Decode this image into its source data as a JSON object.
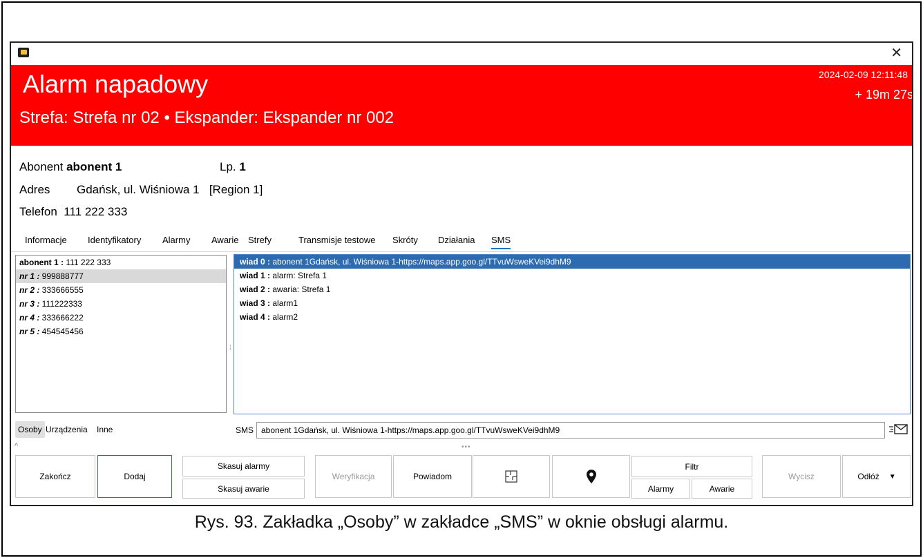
{
  "alarm": {
    "title": "Alarm napadowy",
    "subtitle": "Strefa: Strefa nr 02 • Ekspander: Ekspander nr 002",
    "date": "2024-02-09 12:11:48",
    "elapsed": "+ 19m 27s",
    "color": "#ff0000"
  },
  "info": {
    "abonent_label": "Abonent",
    "abonent_value": "abonent 1",
    "lp_label": "Lp.",
    "lp_value": "1",
    "adres_label": "Adres",
    "adres_value": "Gdańsk, ul. Wiśniowa 1",
    "region": "[Region 1]",
    "telefon_label": "Telefon",
    "telefon_value": "111 222 333"
  },
  "tabs": [
    "Informacje",
    "Identyfikatory",
    "Alarmy",
    "Awarie",
    "Strefy",
    "Transmisje testowe",
    "Skróty",
    "Działania",
    "SMS"
  ],
  "active_tab": "SMS",
  "persons": [
    {
      "name": "abonent 1 :",
      "phone": " 111 222 333"
    },
    {
      "name": "nr 1 :",
      "phone": " 999888777"
    },
    {
      "name": "nr 2 :",
      "phone": " 333666555"
    },
    {
      "name": "nr 3 :",
      "phone": " 111222333"
    },
    {
      "name": "nr 4 :",
      "phone": " 333666222"
    },
    {
      "name": "nr 5 :",
      "phone": " 454545456"
    }
  ],
  "messages": [
    {
      "name": "wiad 0 :",
      "text": " abonent 1Gdańsk, ul. Wiśniowa 1-https://maps.app.goo.gl/TTvuWsweKVei9dhM9"
    },
    {
      "name": "wiad 1 :",
      "text": " alarm: Strefa 1"
    },
    {
      "name": "wiad 2 :",
      "text": " awaria: Strefa 1"
    },
    {
      "name": "wiad 3 :",
      "text": " alarm1"
    },
    {
      "name": "wiad 4 :",
      "text": " alarm2"
    }
  ],
  "subtabs": [
    "Osoby",
    "Urządzenia",
    "Inne"
  ],
  "sms": {
    "label": "SMS",
    "value": "abonent 1Gdańsk, ul. Wiśniowa 1-https://maps.app.goo.gl/TTvuWsweKVei9dhM9"
  },
  "buttons": {
    "zakoncz": "Zakończ",
    "dodaj": "Dodaj",
    "skasuj_alarmy": "Skasuj alarmy",
    "skasuj_awarie": "Skasuj awarie",
    "weryfikacja": "Weryfikacja",
    "powiadom": "Powiadom",
    "filtr": "Filtr",
    "alarmy": "Alarmy",
    "awarie": "Awarie",
    "wycisz": "Wycisz",
    "odloz": "Odłóż"
  },
  "caption": "Rys. 93. Zakładka „Osoby” w zakładce „SMS” w oknie obsługi alarmu."
}
